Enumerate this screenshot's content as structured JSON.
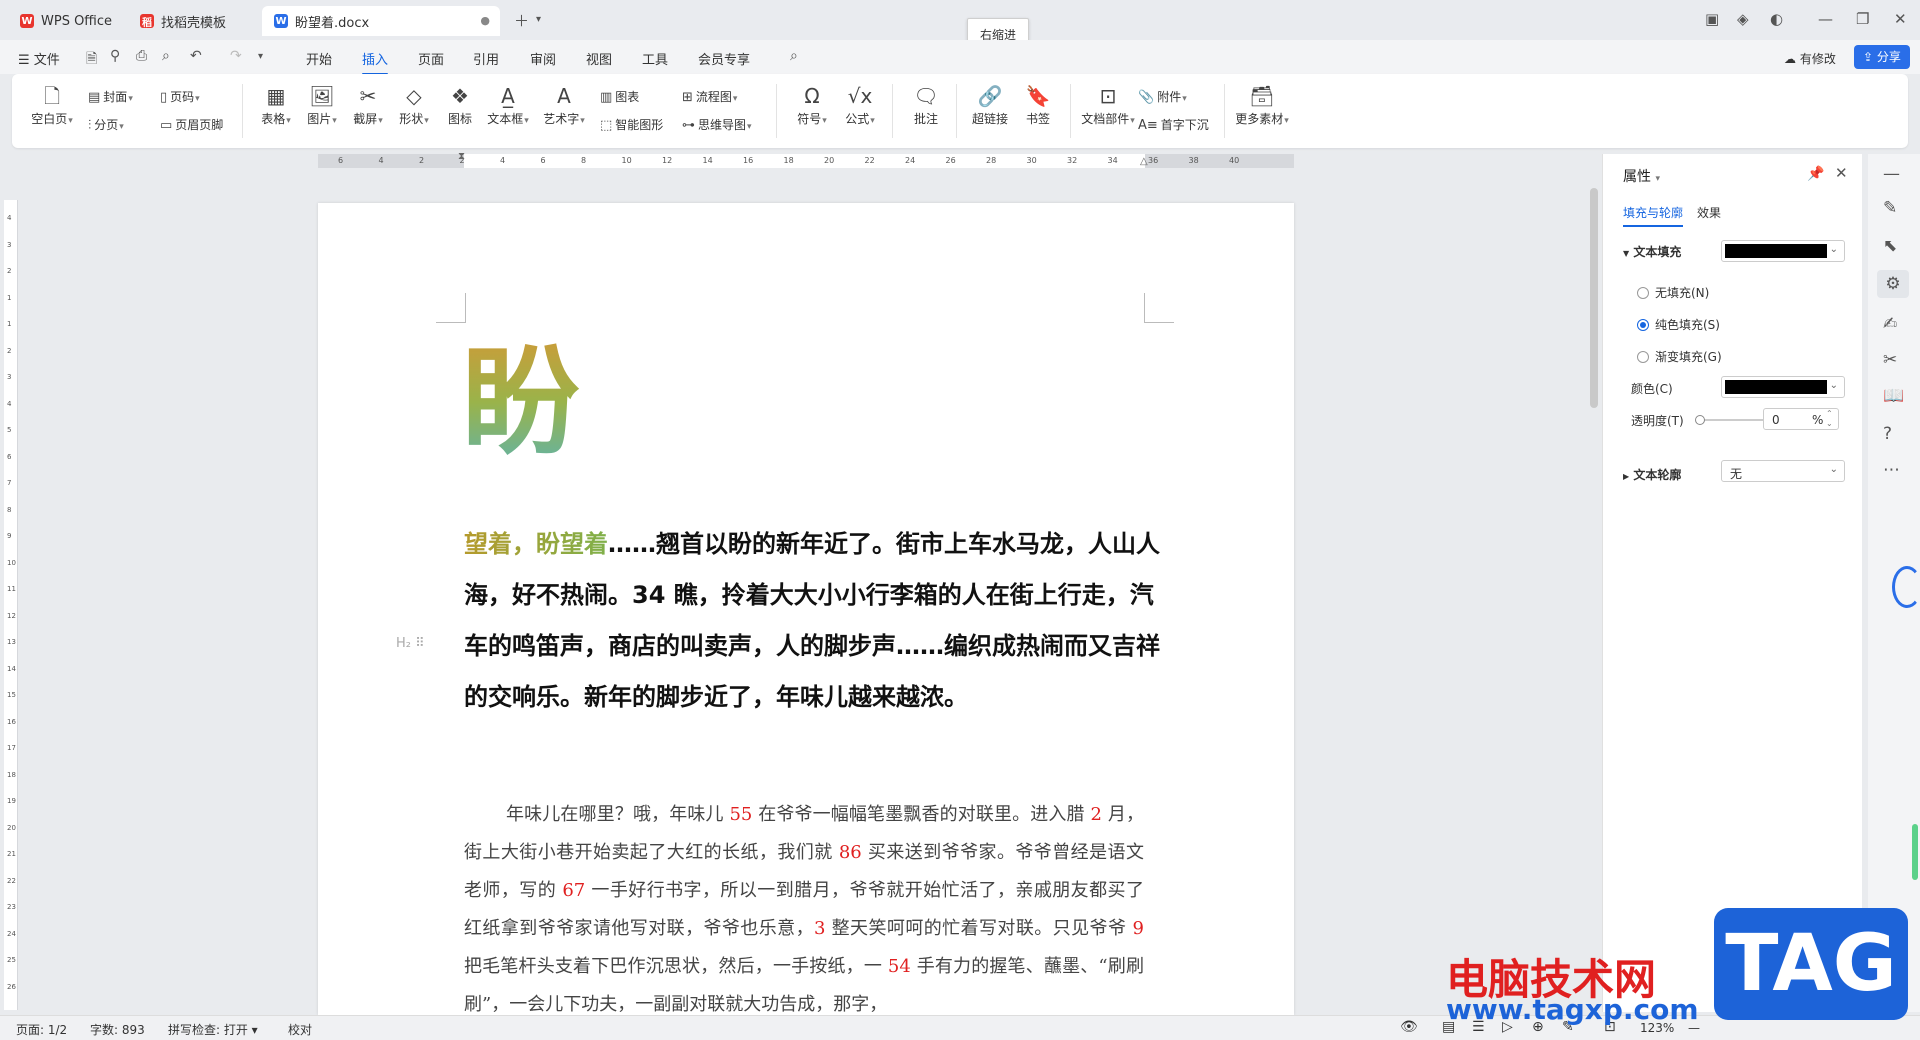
{
  "tabs": [
    {
      "label": "WPS Office",
      "icon": "wps-logo-icon"
    },
    {
      "label": "找稻壳模板",
      "icon": "docer-icon"
    },
    {
      "label": "盼望着.docx",
      "icon": "word-doc-icon"
    }
  ],
  "menu": {
    "file": "文件",
    "items": [
      "开始",
      "插入",
      "页面",
      "引用",
      "审阅",
      "视图",
      "工具",
      "会员专享"
    ],
    "active": "插入",
    "modified": "有修改",
    "share": "分享"
  },
  "tooltip": "右缩进",
  "ribbon": {
    "blank_page": "空白页",
    "cover": "封面",
    "page_break": "分页",
    "page_number": "页码",
    "header_footer": "页眉页脚",
    "table": "表格",
    "picture": "图片",
    "screenshot": "截屏",
    "shape": "形状",
    "icon": "图标",
    "textbox": "文本框",
    "wordart": "艺术字",
    "chart": "图表",
    "smartart": "智能图形",
    "flowchart": "流程图",
    "mindmap": "思维导图",
    "symbol": "符号",
    "formula": "公式",
    "comment": "批注",
    "hyperlink": "超链接",
    "bookmark": "书签",
    "attachment": "附件",
    "doc_parts": "文档部件",
    "dropcap": "首字下沉",
    "more": "更多素材"
  },
  "ruler": {
    "h_ticks": [
      "6",
      "4",
      "2",
      "2",
      "4",
      "6",
      "8",
      "10",
      "12",
      "14",
      "16",
      "18",
      "20",
      "22",
      "24",
      "26",
      "28",
      "30",
      "32",
      "34",
      "36",
      "38",
      "40"
    ],
    "v_ticks": [
      "4",
      "3",
      "2",
      "1",
      "1",
      "2",
      "3",
      "4",
      "5",
      "6",
      "7",
      "8",
      "9",
      "10",
      "11",
      "12",
      "13",
      "14",
      "15",
      "16",
      "17",
      "18",
      "19",
      "20",
      "21",
      "22",
      "23",
      "24",
      "25",
      "26"
    ]
  },
  "document": {
    "dropcap": "盼",
    "heading_highlight": "望着，盼望着",
    "heading_rest": "……翘首以盼的新年近了。街市上车水马龙，人山人海，好不热闹。34 瞧，拎着大大小小行李箱的人在街上行走，汽车的鸣笛声，商店的叫卖声，人的脚步声……编织成热闹而又吉祥的交响乐。新年的脚步近了，年味儿越来越浓。",
    "body_segments": [
      {
        "t": "年味儿在哪里？哦，年味儿 ",
        "num": false
      },
      {
        "t": "55",
        "num": true
      },
      {
        "t": " 在爷爷一幅幅笔墨飘香的对联里。进入腊 ",
        "num": false
      },
      {
        "t": "2",
        "num": true
      },
      {
        "t": " 月，街上大街小巷开始卖起了大红的长纸，我们就 ",
        "num": false
      },
      {
        "t": "86",
        "num": true
      },
      {
        "t": " 买来送到爷爷家。爷爷曾经是语文老师，写的 ",
        "num": false
      },
      {
        "t": "67",
        "num": true
      },
      {
        "t": " 一手好行书字，所以一到腊月，爷爷就开始忙活了，亲戚朋友都买了红纸拿到爷爷家请他写对联，爷爷也乐意，",
        "num": false
      },
      {
        "t": "3",
        "num": true
      },
      {
        "t": " 整天笑呵呵的忙着写对联。只见爷爷 ",
        "num": false
      },
      {
        "t": "9",
        "num": true
      },
      {
        "t": " 把毛笔杆头支着下巴作沉思状，然后，一手按纸，一 ",
        "num": false
      },
      {
        "t": "54",
        "num": true
      },
      {
        "t": " 手有力的握笔、蘸墨、“刷刷刷”，一会儿下功夫，一副副对联就大功告成，那字，",
        "num": false
      }
    ]
  },
  "panel": {
    "title": "属性",
    "tab_fill": "填充与轮廓",
    "tab_effect": "效果",
    "text_fill": "文本填充",
    "no_fill": "无填充(N)",
    "solid_fill": "纯色填充(S)",
    "gradient_fill": "渐变填充(G)",
    "color_label": "颜色(C)",
    "transparency_label": "透明度(T)",
    "transparency_value": "0",
    "percent": "%",
    "text_outline": "文本轮廓",
    "outline_value": "无",
    "fill_color": "#000000"
  },
  "status": {
    "page": "页面: 1/2",
    "words": "字数: 893",
    "spell": "拼写检查: 打开",
    "proof": "校对",
    "zoom": "123%"
  },
  "watermark": {
    "line1": "电脑技术网",
    "line2": "www.tagxp.com",
    "tag": "TAG"
  }
}
